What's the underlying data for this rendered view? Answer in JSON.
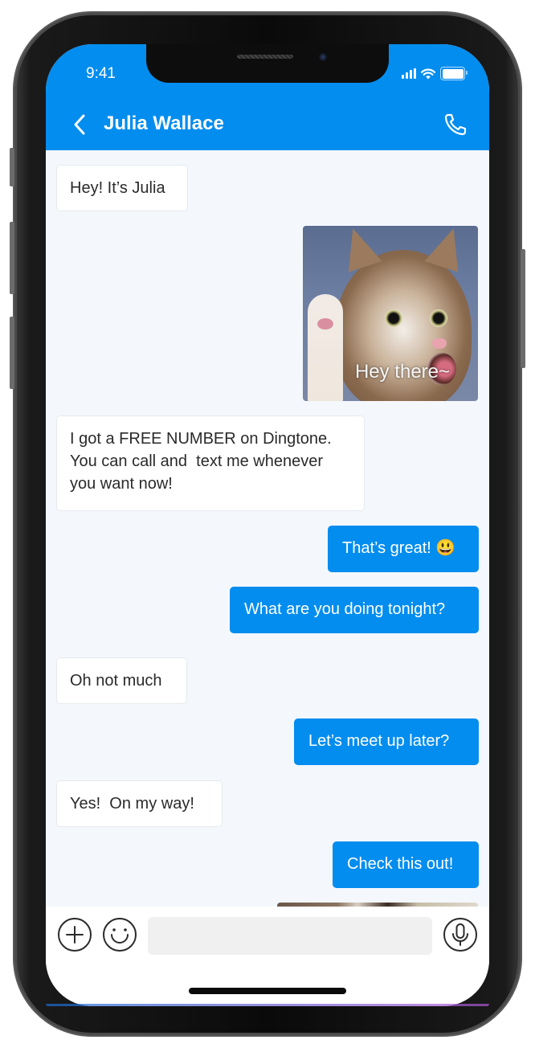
{
  "status_bar": {
    "time": "9:41",
    "signal_icon": "cellular-signal-icon",
    "wifi_icon": "wifi-icon",
    "battery_icon": "battery-icon"
  },
  "header": {
    "title": "Julia Wallace",
    "back_icon": "chevron-left-icon",
    "call_icon": "phone-icon",
    "background_color": "#038def"
  },
  "messages": [
    {
      "direction": "incoming",
      "type": "text",
      "text": "Hey! It’s Julia"
    },
    {
      "direction": "outgoing",
      "type": "image",
      "caption": "Hey there~",
      "alt": "cat waving"
    },
    {
      "direction": "incoming",
      "type": "text",
      "lines": [
        "I got a FREE NUMBER on Dingtone.",
        "You can call and  text me whenever",
        "you want now!"
      ]
    },
    {
      "direction": "outgoing",
      "type": "text",
      "text": "That’s great! 😃"
    },
    {
      "direction": "outgoing",
      "type": "text",
      "text": "What are you doing tonight?"
    },
    {
      "direction": "incoming",
      "type": "text",
      "text": "Oh not much"
    },
    {
      "direction": "outgoing",
      "type": "text",
      "text": "Let’s meet up later?"
    },
    {
      "direction": "incoming",
      "type": "text",
      "text": "Yes!  On my way!"
    },
    {
      "direction": "outgoing",
      "type": "text",
      "text": "Check this out!"
    },
    {
      "direction": "outgoing",
      "type": "image",
      "caption": "",
      "alt": "partially visible image"
    }
  ],
  "composer": {
    "add_icon": "plus-circle-icon",
    "emoji_icon": "smiley-icon",
    "input_value": "",
    "input_placeholder": "",
    "mic_icon": "microphone-icon"
  },
  "colors": {
    "accent": "#038def",
    "chat_background": "#f4f8fc",
    "incoming_bubble": "#ffffff",
    "outgoing_bubble": "#038def"
  }
}
